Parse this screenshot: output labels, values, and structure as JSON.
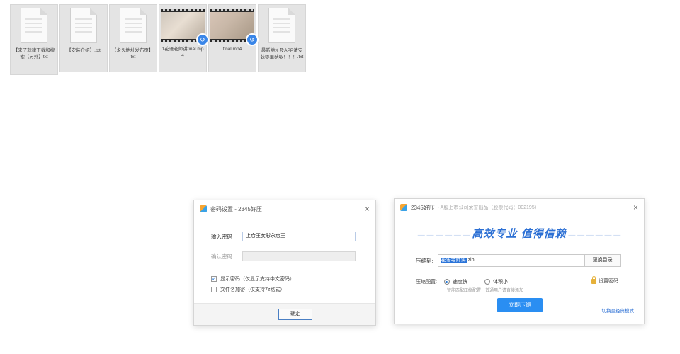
{
  "desktop": {
    "files": [
      {
        "name": "【来了就建下载和搜索（另外】txt",
        "type": "doc"
      },
      {
        "name": "【安装介绍】.txt",
        "type": "doc"
      },
      {
        "name": "【永久地址发布页】.txt",
        "type": "doc"
      },
      {
        "name": "1花语老师讲final.mp4",
        "type": "video"
      },
      {
        "name": "final.mp4",
        "type": "video"
      },
      {
        "name": "最新地址及APP请安装哪里获取！！！.txt",
        "type": "doc"
      }
    ]
  },
  "password_dialog": {
    "title": "密码设置 - 2345好压",
    "enter_label": "输入密码",
    "enter_value": "上仓王女彩永仓王",
    "confirm_label": "确认密码",
    "confirm_value": "",
    "show_password": "显示密码（仅显示支持中文密码）",
    "show_password_checked": true,
    "encrypt_names": "文件名加密（仅支持7z格式）",
    "encrypt_names_checked": false,
    "ok": "确定",
    "close": "×"
  },
  "compress_dialog": {
    "title": "2345好压",
    "subtitle": "· A股上市公司荣誉出品（股票代码：002195）",
    "slogan": "高效专业  值得信赖",
    "package_label": "压缩到:",
    "package_selected": "花语老师讲",
    "package_suffix": ".zip",
    "change_dir": "更换目录",
    "config_label": "压缩配置:",
    "option_fast": "速度快",
    "option_small": "体积小",
    "hint": "智能匹配压缩配置，普通用户请直接添加",
    "set_password": "设置密码",
    "compress_now": "立即压缩",
    "switch_classic": "切换至经典模式",
    "close": "×"
  }
}
